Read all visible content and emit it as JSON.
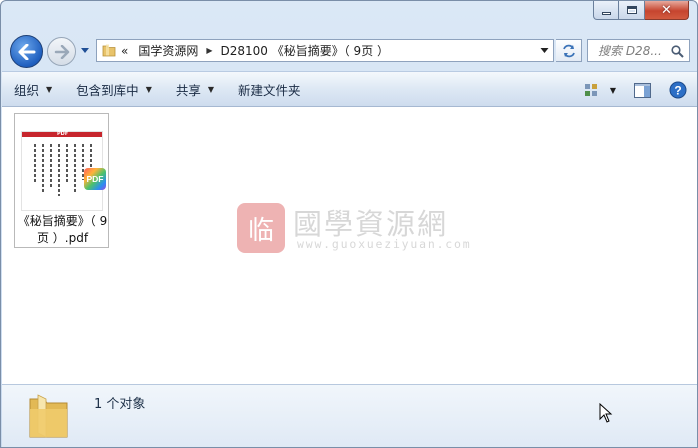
{
  "window": {
    "caption": {
      "minimize": "minimize",
      "maximize": "maximize",
      "close": "close"
    }
  },
  "address": {
    "chevron": "«",
    "crumbs": [
      {
        "label": "国学资源网"
      },
      {
        "label": "D28100 《秘旨摘要》（ 9页 ）"
      }
    ]
  },
  "search": {
    "placeholder": "搜索 D28..."
  },
  "toolbar": {
    "organize": "组织",
    "include_in_library": "包含到库中",
    "share": "共享",
    "new_folder": "新建文件夹"
  },
  "files": [
    {
      "name": "《秘旨摘要》（ 9页 ）.pdf",
      "badge": "PDF",
      "thumb_tag": "PDF"
    }
  ],
  "watermark": {
    "seal_char": "临",
    "title": "國學資源網",
    "url": "www.guoxueziyuan.com"
  },
  "details": {
    "count_text": "1 个对象"
  },
  "colors": {
    "accent": "#1f5fbf",
    "pdf_red": "#c7262d",
    "seal": "#d33a3a"
  }
}
